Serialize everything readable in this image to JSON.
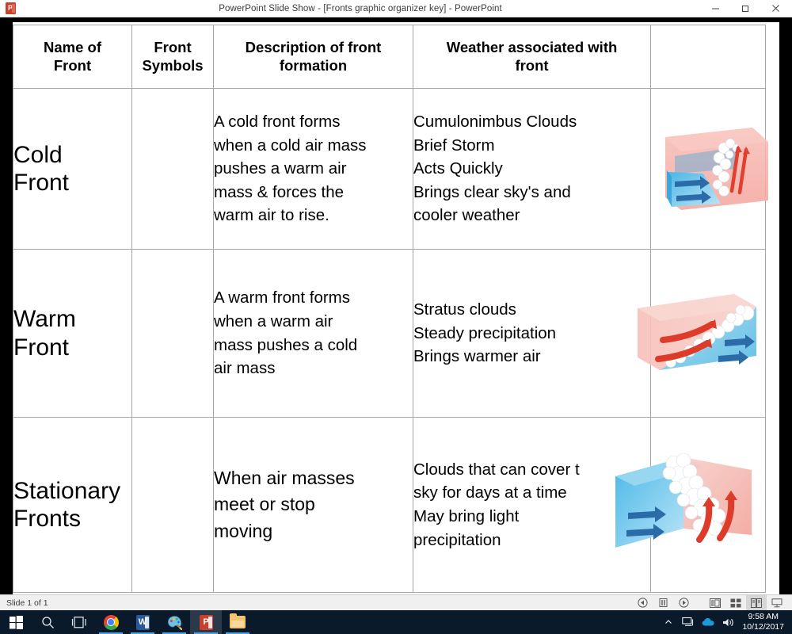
{
  "window": {
    "app_icon": "powerpoint-icon",
    "title": "PowerPoint Slide Show - [Fronts graphic organizer key] - PowerPoint",
    "minimize_label": "–",
    "restore_label": "❐",
    "close_label": "✕"
  },
  "table": {
    "headers": [
      "Name of\nFront",
      "Front\nSymbols",
      "Description of front\nformation",
      "Weather associated with\nfront",
      ""
    ],
    "rows": [
      {
        "name": "Cold\nFront",
        "symbol": "",
        "description": "A cold front forms\nwhen a cold air mass\npushes a warm air\nmass & forces the\nwarm air to rise.",
        "weather": "Cumulonimbus Clouds\nBrief Storm\nActs Quickly\nBrings clear sky's and\ncooler weather",
        "image": "cold-front-diagram"
      },
      {
        "name": " Warm\nFront",
        "symbol": "",
        "description": "A warm front forms\nwhen a warm air\nmass pushes a cold\nair mass",
        "weather": "Stratus clouds\nSteady precipitation\nBrings warmer air",
        "image": "warm-front-diagram"
      },
      {
        "name": "Stationary\nFronts",
        "symbol": "",
        "description": "When air masses\nmeet or stop\nmoving",
        "weather": "Clouds that can cover t\nsky for days at a time\nMay bring light\nprecipitation",
        "image": "stationary-front-diagram"
      }
    ]
  },
  "statusbar": {
    "slide_indicator": "Slide 1 of 1",
    "buttons": [
      "previous-slide-icon",
      "pause-slide-icon",
      "next-slide-icon",
      "normal-view-icon",
      "slide-sorter-icon",
      "reading-view-icon",
      "slide-show-icon"
    ]
  },
  "taskbar": {
    "items": [
      "start-icon",
      "search-icon",
      "task-view-icon",
      "chrome-icon",
      "word-icon",
      "paint-icon",
      "powerpoint-icon",
      "file-explorer-icon"
    ],
    "tray": [
      "show-hidden-icons-icon",
      "network-icon",
      "onedrive-icon",
      "volume-icon"
    ],
    "clock_time": "9:58 AM",
    "clock_date": "10/12/2017"
  },
  "colors": {
    "warm_air": "#f2a6a0",
    "cold_air": "#5db6e0",
    "cloud": "#f2f4f6",
    "red_arrow": "#e0402f",
    "blue_arrow": "#2b6ca8",
    "powerpoint_accent": "#c8402c",
    "taskbar": "#0b1a2b"
  }
}
